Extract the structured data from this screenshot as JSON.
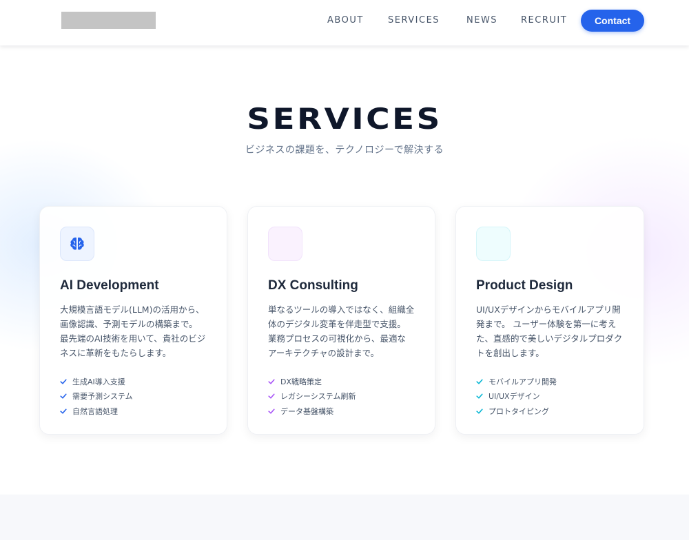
{
  "header": {
    "nav": [
      {
        "label": "ABOUT"
      },
      {
        "label": "SERVICES"
      },
      {
        "label": "NEWS"
      },
      {
        "label": "RECRUIT"
      }
    ],
    "contact_label": "Contact"
  },
  "section": {
    "title": "SERVICES",
    "subtitle": "ビジネスの課題を、テクノロジーで解決する"
  },
  "cards": [
    {
      "icon": "brain-icon",
      "title": "AI Development",
      "description": "大規模言語モデル(LLM)の活用から、\n画像認識、予測モデルの構築まで。\n最先端のAI技術を用いて、貴社のビジ\nネスに革新をもたらします。",
      "features": [
        "生成AI導入支援",
        "需要予測システム",
        "自然言語処理"
      ],
      "accent": "#2563eb"
    },
    {
      "icon": "consulting-icon",
      "title": "DX Consulting",
      "description": "単なるツールの導入ではなく、組織全\n体のデジタル変革を伴走型で支援。\n業務プロセスの可視化から、最適な\nアーキテクチャの設計まで。",
      "features": [
        "DX戦略策定",
        "レガシーシステム刷新",
        "データ基盤構築"
      ],
      "accent": "#a855f7"
    },
    {
      "icon": "design-icon",
      "title": "Product Design",
      "description": "UI/UXデザインからモバイルアプリ開\n発まで。 ユーザー体験を第一に考え\nた、直感的で美しいデジタルプロダク\nトを創出します。",
      "features": [
        "モバイルアプリ開発",
        "UI/UXデザイン",
        "プロトタイピング"
      ],
      "accent": "#06b6d4"
    }
  ],
  "colors": {
    "primary": "#2563eb",
    "purple": "#a855f7",
    "cyan": "#06b6d4",
    "title": "#0f172a",
    "text": "#475569"
  }
}
